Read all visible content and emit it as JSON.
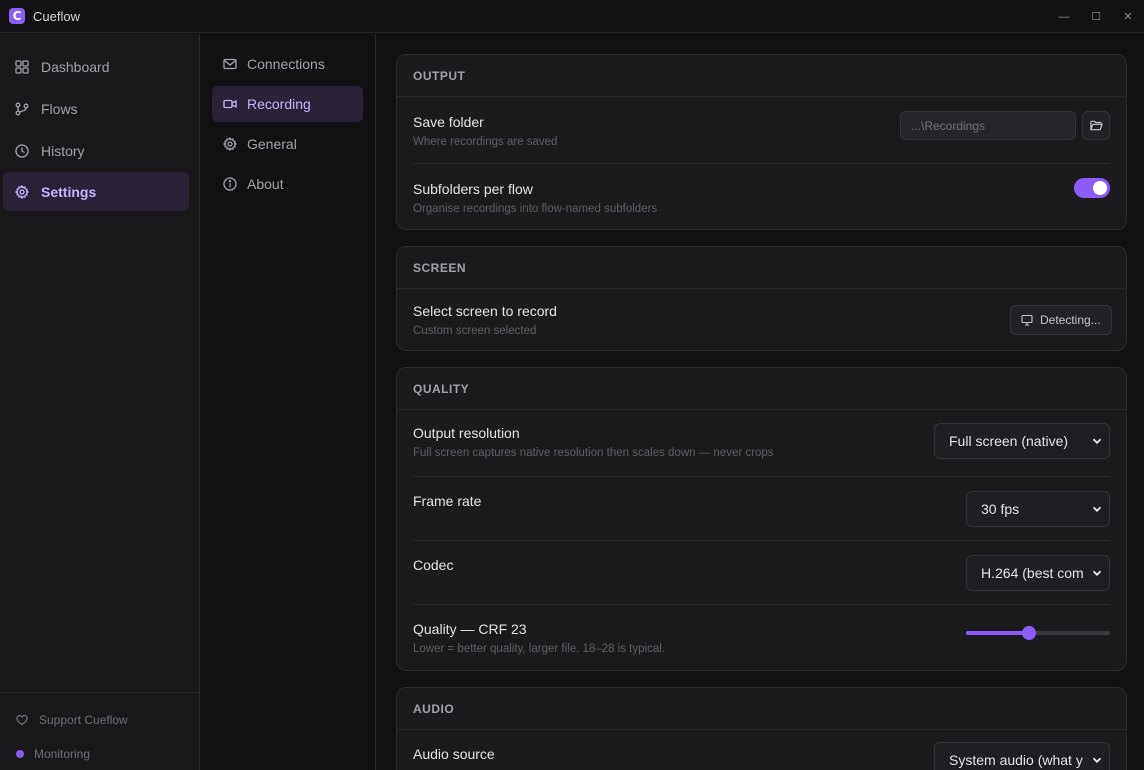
{
  "app": {
    "title": "Cueflow",
    "logo_letter": "C"
  },
  "window": {
    "minimize": "—",
    "maximize": "☐",
    "close": "✕"
  },
  "sidebar": {
    "items": [
      {
        "label": "Dashboard",
        "icon": "grid-icon"
      },
      {
        "label": "Flows",
        "icon": "flow-icon"
      },
      {
        "label": "History",
        "icon": "clock-icon"
      },
      {
        "label": "Settings",
        "icon": "gear-icon",
        "active": true
      }
    ],
    "footer": {
      "support": "Support Cueflow",
      "status": "Monitoring"
    }
  },
  "subnav": {
    "items": [
      {
        "label": "Connections",
        "icon": "mail-icon"
      },
      {
        "label": "Recording",
        "icon": "video-icon",
        "active": true
      },
      {
        "label": "General",
        "icon": "gear-icon"
      },
      {
        "label": "About",
        "icon": "info-icon"
      }
    ]
  },
  "output": {
    "heading": "OUTPUT",
    "save_folder": {
      "label": "Save folder",
      "desc": "Where recordings are saved",
      "value": "...\\Recordings"
    },
    "subfolders": {
      "label": "Subfolders per flow",
      "desc": "Organise recordings into flow-named subfolders",
      "enabled": true
    }
  },
  "screen": {
    "heading": "SCREEN",
    "select": {
      "label": "Select screen to record",
      "desc": "Custom screen selected",
      "button": "Detecting..."
    }
  },
  "quality": {
    "heading": "QUALITY",
    "resolution": {
      "label": "Output resolution",
      "desc": "Full screen captures native resolution then scales down — never crops",
      "value": "Full screen (native)"
    },
    "frame_rate": {
      "label": "Frame rate",
      "value": "30 fps"
    },
    "codec": {
      "label": "Codec",
      "value": "H.264 (best com"
    },
    "crf": {
      "label": "Quality — CRF 23",
      "desc": "Lower = better quality, larger file. 18–28 is typical.",
      "value": 23,
      "fraction": 0.44
    }
  },
  "audio": {
    "heading": "AUDIO",
    "source": {
      "label": "Audio source",
      "value": "System audio (what y"
    }
  },
  "colors": {
    "accent": "#8b5cf6",
    "background": "#121214",
    "card": "#1b1b1e"
  }
}
